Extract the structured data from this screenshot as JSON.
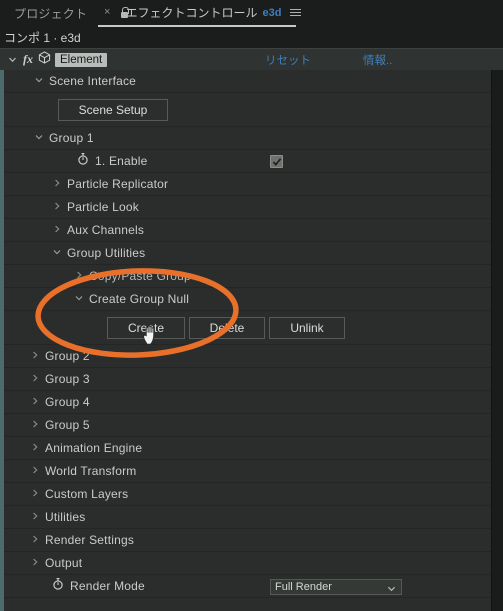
{
  "window": {
    "tab_inactive_label": "プロジェクト",
    "active_tab": {
      "close_label": "×",
      "title": "エフェクトコントロール",
      "subtitle": "e3d"
    },
    "comp_label": "コンポ 1 · e3d"
  },
  "effect_header": {
    "fx_label": "fx",
    "name": "Element",
    "reset_label": "リセット",
    "info_label": "情報.."
  },
  "tree": [
    {
      "label": "Scene Interface",
      "twirl": "down",
      "indent": 30
    },
    {
      "label": "Scene Setup",
      "type": "button-row"
    },
    {
      "label": "Group 1",
      "twirl": "down",
      "indent": 30
    },
    {
      "label": "1. Enable",
      "type": "stopwatch",
      "indent": 73,
      "checked": true
    },
    {
      "label": "Particle Replicator",
      "twirl": "right",
      "indent": 48
    },
    {
      "label": "Particle Look",
      "twirl": "right",
      "indent": 48
    },
    {
      "label": "Aux Channels",
      "twirl": "right",
      "indent": 48
    },
    {
      "label": "Group Utilities",
      "twirl": "down",
      "indent": 48
    },
    {
      "label": "Copy/Paste Group",
      "twirl": "right",
      "indent": 70
    },
    {
      "label": "Create Group Null",
      "twirl": "down",
      "indent": 70
    },
    {
      "label": "",
      "type": "null-buttons"
    },
    {
      "label": "Group 2",
      "twirl": "right",
      "indent": 26
    },
    {
      "label": "Group 3",
      "twirl": "right",
      "indent": 26
    },
    {
      "label": "Group 4",
      "twirl": "right",
      "indent": 26
    },
    {
      "label": "Group 5",
      "twirl": "right",
      "indent": 26
    },
    {
      "label": "Animation Engine",
      "twirl": "right",
      "indent": 26
    },
    {
      "label": "World Transform",
      "twirl": "right",
      "indent": 26
    },
    {
      "label": "Custom Layers",
      "twirl": "right",
      "indent": 26
    },
    {
      "label": "Utilities",
      "twirl": "right",
      "indent": 26
    },
    {
      "label": "Render Settings",
      "twirl": "right",
      "indent": 26
    },
    {
      "label": "Output",
      "twirl": "right",
      "indent": 26
    },
    {
      "label": "Render Mode",
      "type": "dropdown",
      "indent": 48
    }
  ],
  "buttons": {
    "scene_setup": "Scene Setup",
    "create": "Create",
    "delete": "Delete",
    "unlink": "Unlink"
  },
  "dropdown": {
    "render_mode_value": "Full Render"
  },
  "colors": {
    "annotation": "#E8702A",
    "accent_stripe": "#4d6a6c",
    "link": "#3e7fbf",
    "panel_bg": "#2a2d2b"
  }
}
